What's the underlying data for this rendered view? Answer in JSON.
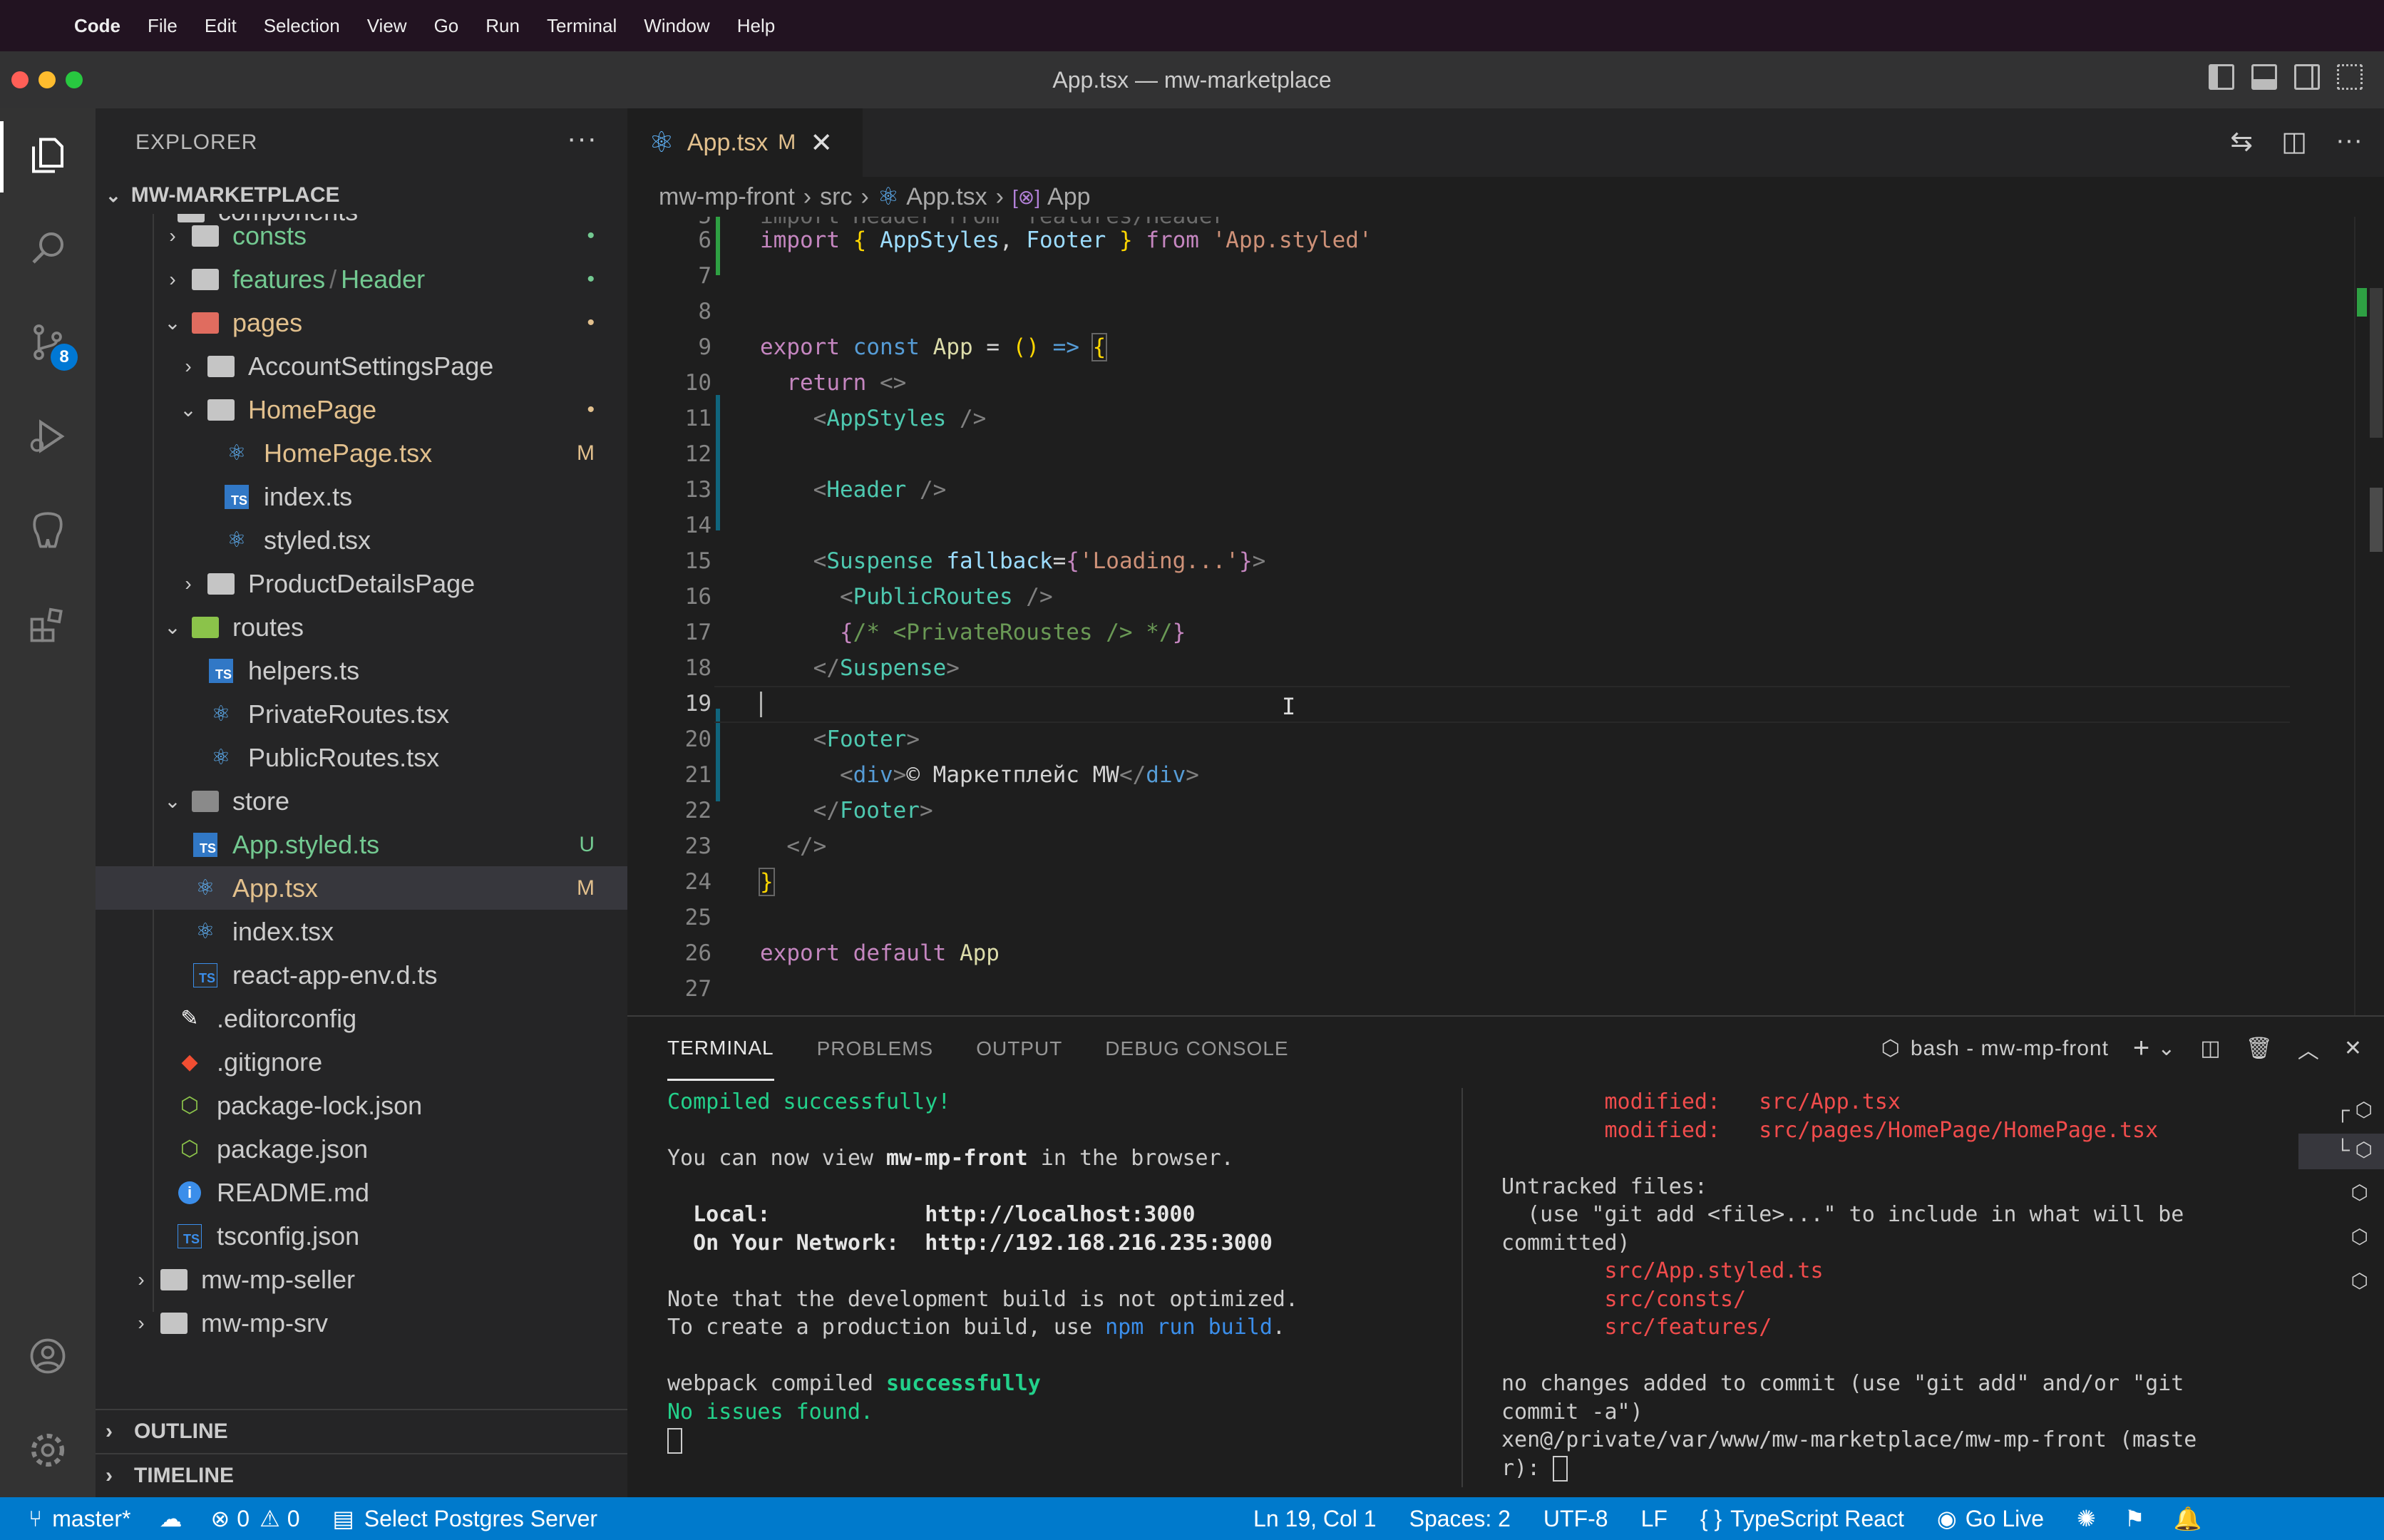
{
  "menubar": {
    "app": "Code",
    "items": [
      "File",
      "Edit",
      "Selection",
      "View",
      "Go",
      "Run",
      "Terminal",
      "Window",
      "Help"
    ]
  },
  "window": {
    "title": "App.tsx — mw-marketplace"
  },
  "sidebar": {
    "title": "EXPLORER",
    "project": "MW-MARKETPLACE",
    "partial_top": "components",
    "items": [
      {
        "label": "consts",
        "status": "•"
      },
      {
        "label": "features",
        "label2": "Header",
        "status": "•"
      },
      {
        "label": "pages",
        "status": "•"
      },
      {
        "label": "AccountSettingsPage",
        "status": ""
      },
      {
        "label": "HomePage",
        "status": "•"
      },
      {
        "label": "HomePage.tsx",
        "status": "M"
      },
      {
        "label": "index.ts",
        "status": ""
      },
      {
        "label": "styled.tsx",
        "status": ""
      },
      {
        "label": "ProductDetailsPage",
        "status": ""
      },
      {
        "label": "routes",
        "status": ""
      },
      {
        "label": "helpers.ts",
        "status": ""
      },
      {
        "label": "PrivateRoutes.tsx",
        "status": ""
      },
      {
        "label": "PublicRoutes.tsx",
        "status": ""
      },
      {
        "label": "store",
        "status": ""
      },
      {
        "label": "App.styled.ts",
        "status": "U"
      },
      {
        "label": "App.tsx",
        "status": "M"
      },
      {
        "label": "index.tsx",
        "status": ""
      },
      {
        "label": "react-app-env.d.ts",
        "status": ""
      },
      {
        "label": ".editorconfig",
        "status": ""
      },
      {
        "label": ".gitignore",
        "status": ""
      },
      {
        "label": "package-lock.json",
        "status": ""
      },
      {
        "label": "package.json",
        "status": ""
      },
      {
        "label": "README.md",
        "status": ""
      },
      {
        "label": "tsconfig.json",
        "status": ""
      },
      {
        "label": "mw-mp-seller",
        "status": ""
      },
      {
        "label": "mw-mp-srv",
        "status": ""
      }
    ],
    "outline": "OUTLINE",
    "timeline": "TIMELINE"
  },
  "activity": {
    "scm_badge": "8"
  },
  "editor": {
    "tab": {
      "name": "App.tsx",
      "modified": "M"
    },
    "breadcrumb": [
      "mw-mp-front",
      "src",
      "App.tsx",
      "App"
    ],
    "lines": [
      {
        "n": "5",
        "partial": "import Header from 'features/Header'"
      },
      {
        "n": "6",
        "code": "import { AppStyles, Footer } from 'App.styled'"
      },
      {
        "n": "7",
        "code": ""
      },
      {
        "n": "8",
        "code": ""
      },
      {
        "n": "9",
        "code": "export const App = () => {"
      },
      {
        "n": "10",
        "code": "  return <>"
      },
      {
        "n": "11",
        "code": "    <AppStyles />"
      },
      {
        "n": "12",
        "code": ""
      },
      {
        "n": "13",
        "code": "    <Header />"
      },
      {
        "n": "14",
        "code": ""
      },
      {
        "n": "15",
        "code": "    <Suspense fallback={'Loading...'}>"
      },
      {
        "n": "16",
        "code": "      <PublicRoutes />"
      },
      {
        "n": "17",
        "code": "      {/* <PrivateRoustes /> */}"
      },
      {
        "n": "18",
        "code": "    </Suspense>"
      },
      {
        "n": "19",
        "code": ""
      },
      {
        "n": "20",
        "code": "    <Footer>"
      },
      {
        "n": "21",
        "code": "      <div>© Маркетплейс MW</div>"
      },
      {
        "n": "22",
        "code": "    </Footer>"
      },
      {
        "n": "23",
        "code": "  </>"
      },
      {
        "n": "24",
        "code": "}"
      },
      {
        "n": "25",
        "code": ""
      },
      {
        "n": "26",
        "code": "export default App"
      },
      {
        "n": "27",
        "code": ""
      }
    ]
  },
  "panel": {
    "tabs": [
      "TERMINAL",
      "PROBLEMS",
      "OUTPUT",
      "DEBUG CONSOLE"
    ],
    "shell": "bash - mw-mp-front",
    "left": {
      "compiled": "Compiled successfully!",
      "view_pre": "You can now view ",
      "view_app": "mw-mp-front",
      "view_post": " in the browser.",
      "local_label": "Local:",
      "local_url": "http://localhost:3000",
      "network_label": "On Your Network:",
      "network_url": "http://192.168.216.235:3000",
      "note1": "Note that the development build is not optimized.",
      "note2_pre": "To create a production build, use ",
      "note2_cmd": "npm run build",
      "note2_post": ".",
      "webpack_pre": "webpack compiled ",
      "webpack_ok": "successfully",
      "no_issues": "No issues found."
    },
    "right": {
      "mod1_label": "modified:",
      "mod1_file": "src/App.tsx",
      "mod2_label": "modified:",
      "mod2_file": "src/pages/HomePage/HomePage.tsx",
      "untracked": "Untracked files:",
      "hint1": "  (use \"git add <file>...\" to include in what will be",
      "hint2": "committed)",
      "u1": "src/App.styled.ts",
      "u2": "src/consts/",
      "u3": "src/features/",
      "nochg1": "no changes added to commit (use \"git add\" and/or \"git",
      "nochg2": "commit -a\")",
      "prompt1": "xen@/private/var/www/mw-marketplace/mw-mp-front (maste",
      "prompt2": "r): "
    }
  },
  "status": {
    "branch": "master*",
    "errors": "0",
    "warnings": "0",
    "postgres": "Select Postgres Server",
    "position": "Ln 19, Col 1",
    "spaces": "Spaces: 2",
    "encoding": "UTF-8",
    "eol": "LF",
    "language": "TypeScript React",
    "golive": "Go Live"
  }
}
